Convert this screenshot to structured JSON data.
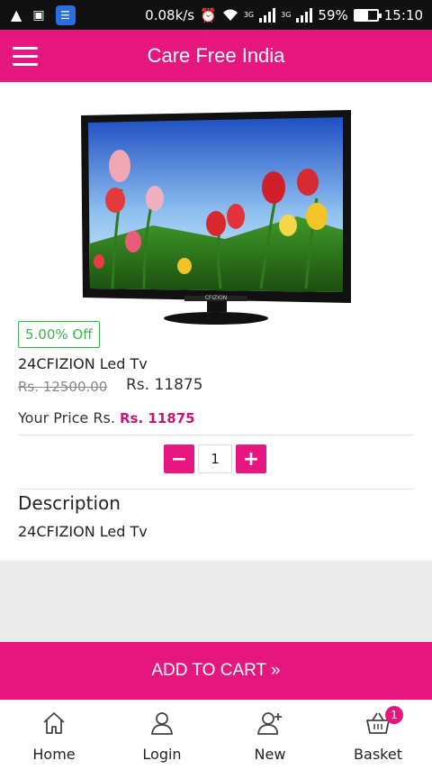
{
  "status_bar": {
    "net_speed": "0.08k/s",
    "net_type_1": "3G",
    "net_type_2": "3G",
    "battery_percent": "59%",
    "time": "15:10",
    "battery_level": 0.59,
    "icons": [
      "warning-icon",
      "screenshot-icon",
      "app-icon",
      "alarm-icon",
      "wifi-icon",
      "signal-icon",
      "battery-icon"
    ]
  },
  "app_bar": {
    "title": "Care Free India",
    "menu_icon": "hamburger-menu-icon"
  },
  "product": {
    "image_icon": "led-tv-image",
    "discount": "5.00% Off",
    "name": "24CFIZION Led Tv",
    "mrp": "Rs. 12500.00",
    "sale_price": "Rs. 11875",
    "your_price_label": "Your Price Rs.",
    "your_price_value": "Rs. 11875",
    "quantity": "1",
    "tv_brand_label": "CFIZION"
  },
  "description": {
    "heading": "Description",
    "text": "24CFIZION Led Tv"
  },
  "cart_button": {
    "label": "ADD TO CART »"
  },
  "bottom_nav": {
    "items": [
      {
        "label": "Home",
        "icon": "home-icon"
      },
      {
        "label": "Login",
        "icon": "user-icon"
      },
      {
        "label": "New",
        "icon": "add-user-icon"
      },
      {
        "label": "Basket",
        "icon": "basket-icon"
      }
    ],
    "basket_count": "1"
  },
  "colors": {
    "accent": "#e5177f",
    "discount": "#39b54a",
    "price_accent": "#c4177a",
    "status_bar": "#111111"
  }
}
